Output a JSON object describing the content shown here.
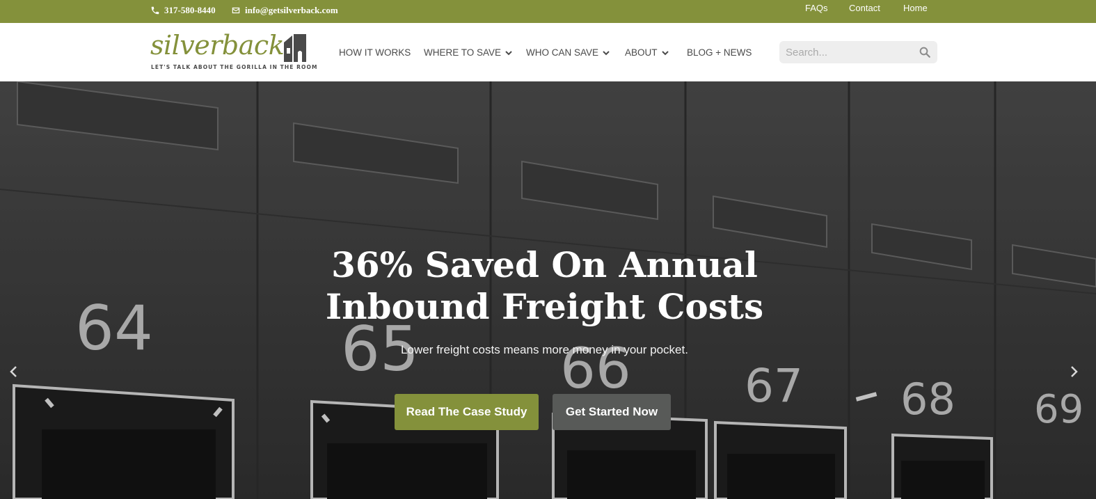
{
  "topbar": {
    "phone": "317-580-8440",
    "email": "info@getsilverback.com",
    "links": [
      "FAQs",
      "Contact",
      "Home"
    ],
    "color": "#84913b"
  },
  "header": {
    "logo": {
      "wordmark": "silverback",
      "tagline": "LET'S TALK ABOUT THE GORILLA IN THE ROOM"
    },
    "nav": [
      {
        "label": "HOW IT WORKS",
        "dropdown": false
      },
      {
        "label": "WHERE TO SAVE",
        "dropdown": true
      },
      {
        "label": "WHO CAN SAVE",
        "dropdown": true
      },
      {
        "label": "ABOUT",
        "dropdown": true
      },
      {
        "label": "BLOG + NEWS",
        "dropdown": false
      }
    ],
    "search": {
      "placeholder": "Search...",
      "value": ""
    }
  },
  "hero": {
    "title_line1": "36% Saved On Annual",
    "title_line2": "Inbound Freight Costs",
    "subtitle": "Lower freight costs means more money in your pocket.",
    "primary_button": "Read The Case Study",
    "secondary_button": "Get Started Now",
    "dock_numbers": [
      "64",
      "65",
      "66",
      "67",
      "68",
      "69"
    ]
  },
  "icons": {
    "phone": "phone-icon",
    "email": "envelope-icon",
    "search": "search-icon",
    "prev": "chevron-left-icon",
    "next": "chevron-right-icon"
  },
  "colors": {
    "accent": "#84913b",
    "dark_button": "#585a58",
    "nav_text": "#4a4a4a"
  }
}
